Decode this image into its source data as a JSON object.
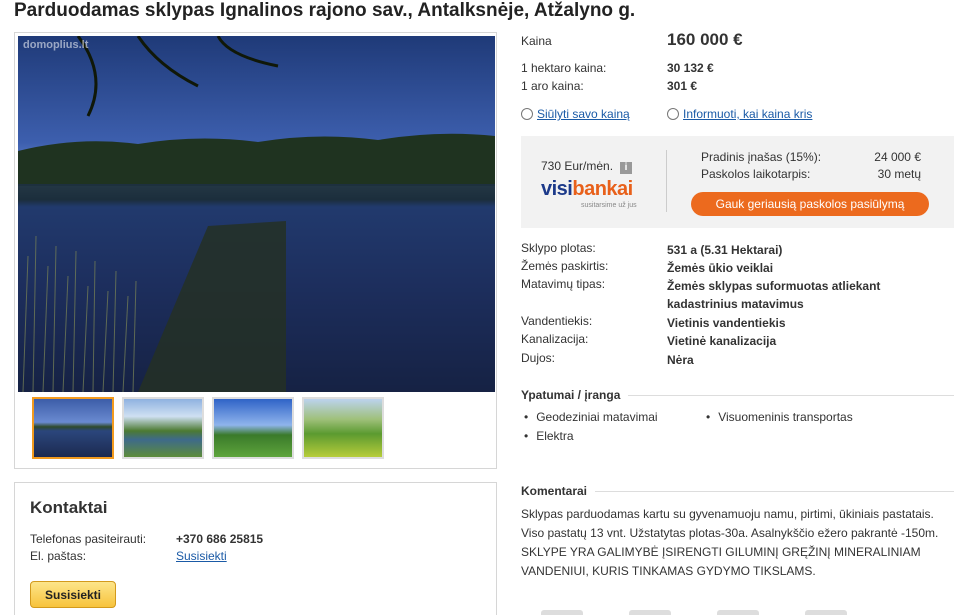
{
  "title": "Parduodamas sklypas Ignalinos rajono sav., Antalksnėje, Atžalyno g.",
  "gallery": {
    "watermark": "domoplius.lt",
    "thumbs": [
      "thumb-1",
      "thumb-2",
      "thumb-3",
      "thumb-4"
    ]
  },
  "price": {
    "label": "Kaina",
    "value": "160 000 €",
    "per_hectare_label": "1 hektaro kaina:",
    "per_hectare_value": "30 132 €",
    "per_are_label": "1 aro kaina:",
    "per_are_value": "301 €"
  },
  "links": {
    "offer_price": "Siūlyti savo kainą",
    "notify": "Informuoti, kai kaina kris"
  },
  "loan": {
    "monthly": "730 Eur/mėn.",
    "logo_a": "visi",
    "logo_b": "bankai",
    "logo_sub": "susitarsime už jus",
    "down_payment_label": "Pradinis įnašas (15%):",
    "down_payment_value": "24 000 €",
    "term_label": "Paskolos laikotarpis:",
    "term_value": "30 metų",
    "button": "Gauk geriausią paskolos pasiūlymą"
  },
  "specs": [
    {
      "label": "Sklypo plotas:",
      "value": "531 a (5.31 Hektarai)"
    },
    {
      "label": "Žemės paskirtis:",
      "value": "Žemės ūkio veiklai"
    },
    {
      "label": "Matavimų tipas:",
      "value": "Žemės sklypas suformuotas atliekant kadastrinius matavimus"
    },
    {
      "label": "Vandentiekis:",
      "value": "Vietinis vandentiekis"
    },
    {
      "label": "Kanalizacija:",
      "value": "Vietinė kanalizacija"
    },
    {
      "label": "Dujos:",
      "value": "Nėra"
    }
  ],
  "features": {
    "heading": "Ypatumai / įranga",
    "items": [
      "Geodeziniai matavimai",
      "Visuomeninis transportas",
      "Elektra"
    ]
  },
  "comments": {
    "heading": "Komentarai",
    "text": "Sklypas parduodamas kartu su gyvenamuoju namu, pirtimi, ūkiniais pastatais. Viso pastatų 13 vnt. Užstatytas plotas-30a. Asalnykščio ežero pakrantė -150m. SKLYPE YRA GALIMYBĖ ĮSIRENGTI GILUMINĮ GRĘŽINĮ MINERALINIAM VANDENIUI, KURIS TINKAMAS GYDYMO TIKSLAMS."
  },
  "contacts": {
    "heading": "Kontaktai",
    "phone_label": "Telefonas pasiteirauti:",
    "phone_value": "+370 686 25815",
    "email_label": "El. paštas:",
    "email_value": "Susisiekti",
    "button": "Susisiekti"
  }
}
